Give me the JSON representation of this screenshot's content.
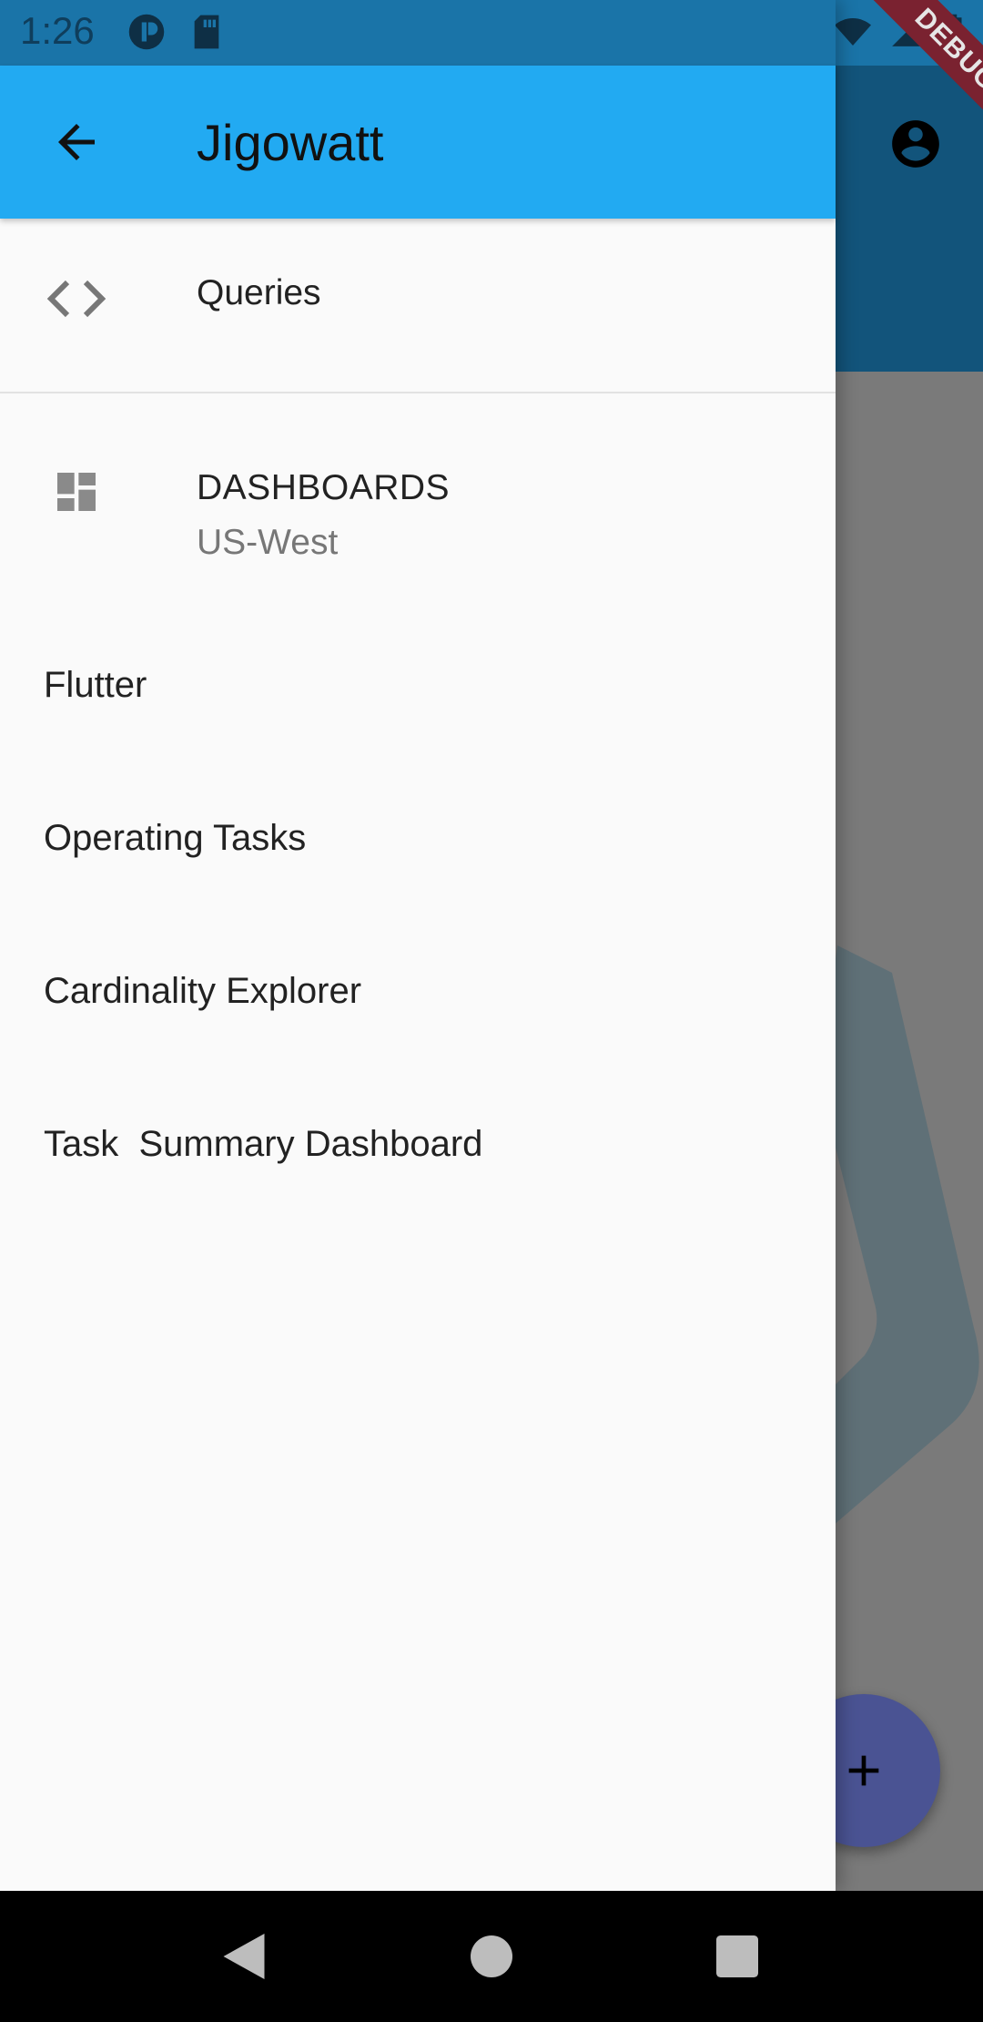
{
  "status_bar": {
    "time": "1:26",
    "left_icons": [
      "app-icon",
      "sd-card-icon"
    ],
    "right_icons": [
      "wifi-icon",
      "signal-icon",
      "battery-icon"
    ]
  },
  "debug_banner": {
    "label": "DEBUG"
  },
  "drawer": {
    "header": {
      "title": "Jigowatt",
      "back_icon": "arrow-back-icon"
    },
    "queries": {
      "label": "Queries",
      "icon": "code-icon"
    },
    "dashboards": {
      "title": "DASHBOARDS",
      "subtitle": "US-West",
      "icon": "dashboard-icon"
    },
    "dashboard_items": [
      {
        "label": "Flutter"
      },
      {
        "label": "Operating Tasks"
      },
      {
        "label": "Cardinality Explorer"
      },
      {
        "label": "Task  Summary Dashboard"
      }
    ]
  },
  "background": {
    "account_icon": "account-circle-icon",
    "fab_icon": "add-icon"
  },
  "nav_bar": {
    "buttons": [
      "back-nav",
      "home-nav",
      "recents-nav"
    ]
  },
  "colors": {
    "header": "#22aaf2",
    "status": "#1a74a8",
    "drawer_bg": "#fafafa",
    "fab": "#4a5393",
    "debug": "#7a2230"
  }
}
